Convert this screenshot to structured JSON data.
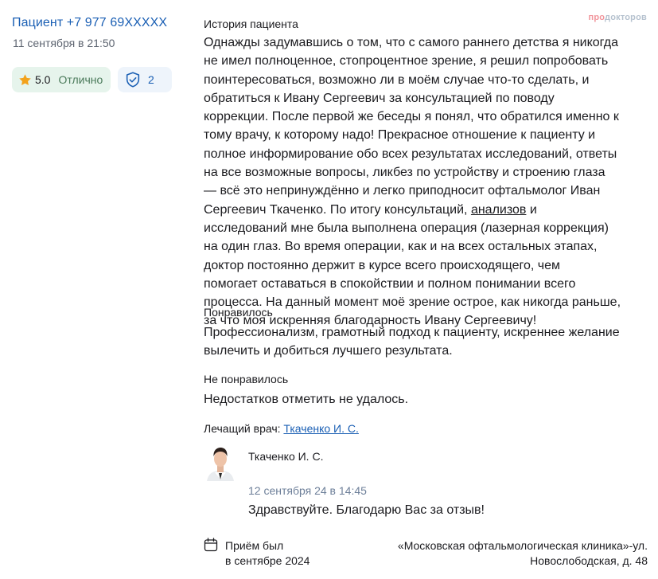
{
  "patient": {
    "name": "Пациент +7 977 69XXXXX",
    "date": "11 сентября в 21:50",
    "rating": "5.0",
    "rating_label": "Отлично",
    "verified_count": "2"
  },
  "logo": {
    "part1": "про",
    "part2": "докторов"
  },
  "history": {
    "title": "История пациента",
    "lines": [
      "Однажды задумавшись о том, что с самого раннего детства я никогда",
      "не имел полноценное, стопроцентное зрение, я решил попробовать",
      "поинтересоваться, возможно ли в моём случае что-то сделать, и",
      "обратиться к Ивану Сергеевич за консультацией по поводу",
      "коррекции. После первой же беседы я понял, что обратился именно к",
      "тому врачу, к которому надо! Прекрасное отношение к пациенту и",
      "полное информирование обо всех результатах исследований, ответы",
      "на все возможные вопросы, ликбез по устройству и строению глаза",
      "— всё это непринуждённо и легко приподносит офтальмолог Иван"
    ],
    "line10_before": "Сергеевич Ткаченко. По итогу консультаций, ",
    "line10_link": "анализов",
    "line10_after": " и",
    "lines_after": [
      "исследований мне была выполнена операция (лазерная коррекция)",
      "на один глаз. Во время операции, как и на всех остальных этапах,",
      "доктор постоянно держит в курсе всего происходящего, чем",
      "помогает оставаться в спокойствии и полном понимании всего",
      "процесса. На данный момент моё зрение острое, как никогда раньше,",
      "за что моя искренняя благодарность Ивану Сергеевичу!"
    ]
  },
  "liked": {
    "title": "Понравилось",
    "lines": [
      "Профессионализм, грамотный подход к пациенту, искреннее желание",
      "вылечить и добиться лучшего результата."
    ]
  },
  "disliked": {
    "title": "Не понравилось",
    "text": "Недостатков отметить не удалось."
  },
  "doctor": {
    "label": "Лечащий врач:",
    "name": "Ткаченко И. С."
  },
  "reply": {
    "author": "Ткаченко И. С.",
    "date": "12 сентября 24 в 14:45",
    "text": "Здравствуйте. Благодарю Вас за отзыв!"
  },
  "visit": {
    "line1": "Приём был",
    "line2": "в сентябре 2024"
  },
  "clinic": {
    "line1": "«Московская офтальмологическая клиника»-ул.",
    "line2": "Новослободская, д. 48"
  }
}
